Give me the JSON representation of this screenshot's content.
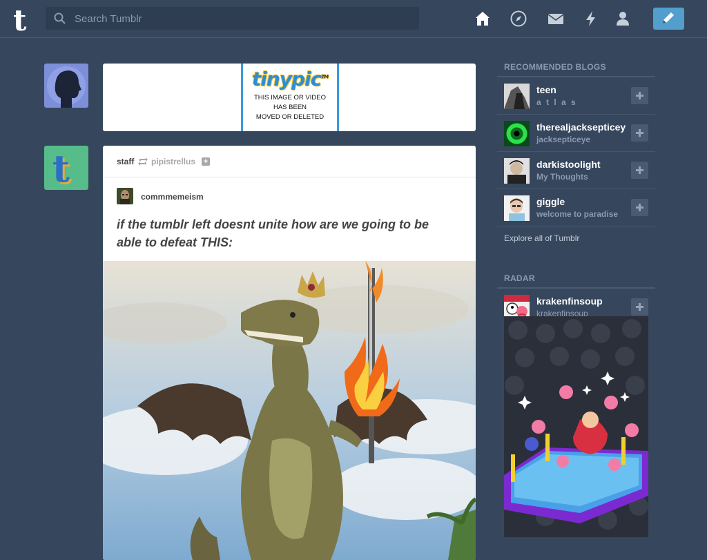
{
  "app": {
    "name": "Tumblr"
  },
  "header": {
    "logo_letter": "t",
    "search_placeholder": "Search Tumblr",
    "nav": [
      "home-icon",
      "explore-compass-icon",
      "inbox-mail-icon",
      "activity-lightning-icon",
      "account-person-icon"
    ],
    "compose_icon": "pencil-icon",
    "accent_color": "#529ecc",
    "background_color": "#36465d"
  },
  "posts": [
    {
      "type": "photo",
      "tinypic": {
        "logo": "tinypic",
        "tm": "TM",
        "message_lines": [
          "THIS IMAGE OR VIDEO",
          "HAS BEEN",
          "MOVED OR DELETED"
        ]
      }
    },
    {
      "type": "photo",
      "author": "staff",
      "reblogged_from": "pipistrellus",
      "source": "commmemeism",
      "caption": "if the tumblr left doesnt unite how are we going to be able to defeat THIS:"
    }
  ],
  "sidebar": {
    "recommended_title": "RECOMMENDED BLOGS",
    "blogs": [
      {
        "name": "teen",
        "subtitle": "a t l a s"
      },
      {
        "name": "therealjacksepticeye",
        "subtitle": "jacksepticeye"
      },
      {
        "name": "darkistoolight",
        "subtitle": "My Thoughts"
      },
      {
        "name": "giggle",
        "subtitle": "welcome to paradise"
      }
    ],
    "explore_link": "Explore all of Tumblr",
    "radar_title": "RADAR",
    "radar": {
      "name": "krakenfinsoup",
      "subtitle": "krakenfinsoup"
    }
  }
}
